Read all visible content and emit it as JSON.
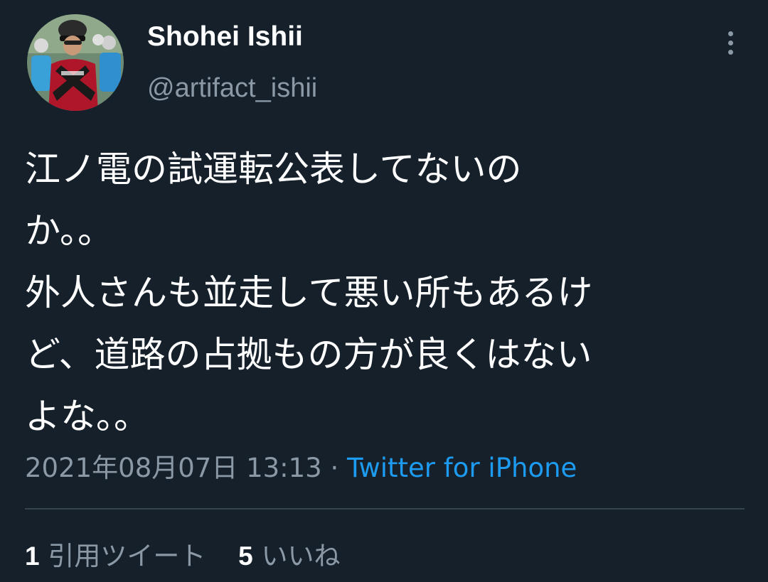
{
  "user": {
    "display_name": "Shohei Ishii",
    "handle": "@artifact_ishii"
  },
  "tweet": {
    "lines": [
      "江ノ電の試運転公表してないの",
      "か。。",
      "外人さんも並走して悪い所もあるけ",
      "ど、道路の占拠もの方が良くはない",
      "よな。。"
    ],
    "timestamp": "2021年08月07日 13:13",
    "separator": "·",
    "source": "Twitter for iPhone"
  },
  "stats": {
    "quote_count": "1",
    "quote_label": "引用ツイート",
    "like_count": "5",
    "like_label": "いいね"
  },
  "icons": {
    "more": "more-vertical-icon",
    "avatar": "cyclist-photo"
  },
  "colors": {
    "background": "#15202b",
    "text": "#ffffff",
    "muted": "#8b98a5",
    "link": "#1d9bf0",
    "divider": "#38444d"
  }
}
